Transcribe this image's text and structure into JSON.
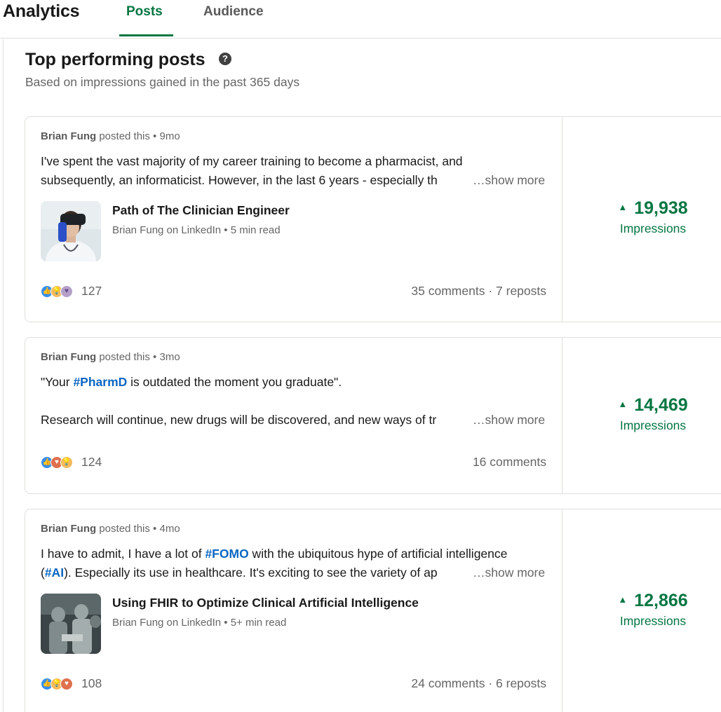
{
  "header": {
    "app_title": "Analytics",
    "tabs": [
      {
        "label": "Posts",
        "active": true
      },
      {
        "label": "Audience",
        "active": false
      }
    ],
    "accent_color": "#057642"
  },
  "section": {
    "title": "Top performing posts",
    "subtitle": "Based on impressions gained in the past 365 days",
    "help_icon": "question-circle-icon"
  },
  "posts": [
    {
      "author": "Brian Fung",
      "meta_suffix": "posted this • 9mo",
      "line1": "I've spent the vast majority of my career training to become a pharmacist, and",
      "line2": "subsequently, an informaticist. However, in the last 6 years - especially th",
      "show_more": "…show more",
      "article_title": "Path of The Clinician Engineer",
      "article_sub": "Brian Fung on LinkedIn • 5 min read",
      "reaction_count": "127",
      "engagement": "35 comments · 7 reposts",
      "impressions": "19,938",
      "impressions_label": "Impressions"
    },
    {
      "author": "Brian Fung",
      "meta_suffix": "posted this • 3mo",
      "line1_pre": "\"Your ",
      "line1_tag": "#PharmD",
      "line1_post": " is outdated the moment you graduate\".",
      "line2": "Research will continue, new drugs will be discovered, and new ways of tr",
      "show_more": "…show more",
      "reaction_count": "124",
      "engagement": "16 comments",
      "impressions": "14,469",
      "impressions_label": "Impressions"
    },
    {
      "author": "Brian Fung",
      "meta_suffix": "posted this • 4mo",
      "line1_pre": "I have to admit, I have a lot of ",
      "line1_tag": "#FOMO",
      "line1_post": " with the ubiquitous hype of artificial intelligence",
      "line2_pre": "(",
      "line2_tag": "#AI",
      "line2_post": "). Especially its use in healthcare. It's exciting to see the variety of ap",
      "show_more": "…show more",
      "article_title": "Using FHIR to Optimize Clinical Artificial Intelligence",
      "article_sub": "Brian Fung on LinkedIn • 5+ min read",
      "reaction_count": "108",
      "engagement": "24 comments · 6 reposts",
      "impressions": "12,866",
      "impressions_label": "Impressions"
    }
  ]
}
